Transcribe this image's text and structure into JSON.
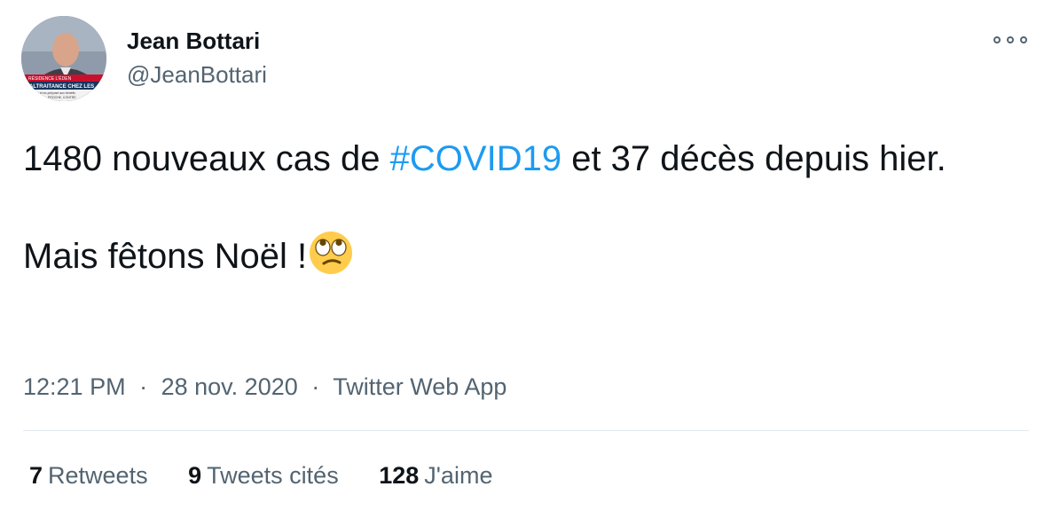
{
  "author": {
    "name": "Jean Bottari",
    "handle": "@JeanBottari",
    "avatar_caption_lines": [
      "RÉSIDENCE L'ÉDEN",
      "MALTRAITANCE CHEZ LES",
      "ette et ex-préposé aux bénéfic",
      "PROCHE, CONTRE"
    ]
  },
  "more_icon": "more-horizontal-icon",
  "tweet": {
    "text_before_hashtag": "1480 nouveaux cas de ",
    "hashtag": "#COVID19",
    "text_after_hashtag": " et 37 décès depuis hier.",
    "second_paragraph": "Mais fêtons Noël !",
    "emoji": "face-with-rolling-eyes-emoji"
  },
  "meta": {
    "time": "12:21 PM",
    "date": "28 nov. 2020",
    "separator": "·",
    "source": "Twitter Web App"
  },
  "stats": [
    {
      "count": "7",
      "label": "Retweets"
    },
    {
      "count": "9",
      "label": "Tweets cités"
    },
    {
      "count": "128",
      "label": "J'aime"
    }
  ],
  "colors": {
    "link": "#1d9bf0",
    "secondary_text": "#536471",
    "primary_text": "#0f1419",
    "divider": "#e1e8ed"
  }
}
